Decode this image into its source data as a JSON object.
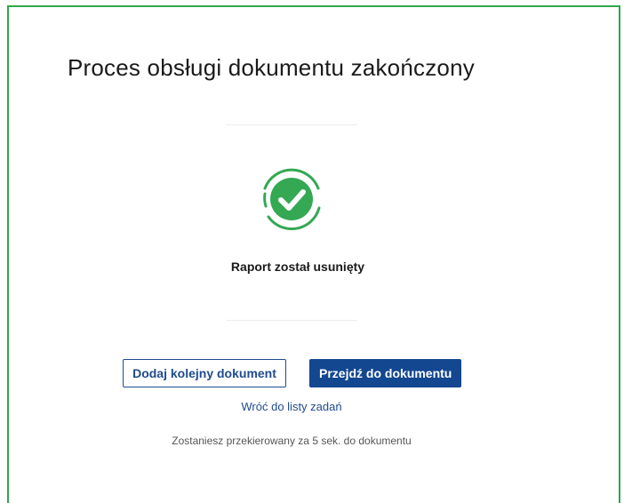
{
  "page": {
    "title": "Proces obsługi dokumentu zakończony"
  },
  "status": {
    "icon": "check-circle-icon",
    "message": "Raport został usunięty",
    "color": "#34a853"
  },
  "actions": {
    "add_document_label": "Dodaj kolejny dokument",
    "go_to_document_label": "Przejdź do dokumentu",
    "back_link_label": "Wróć do listy zadań"
  },
  "redirect": {
    "note": "Zostaniesz przekierowany za 5 sek. do dokumentu"
  },
  "colors": {
    "frame_border": "#2ea84a",
    "primary": "#13478f",
    "link": "#1f4b8e"
  }
}
